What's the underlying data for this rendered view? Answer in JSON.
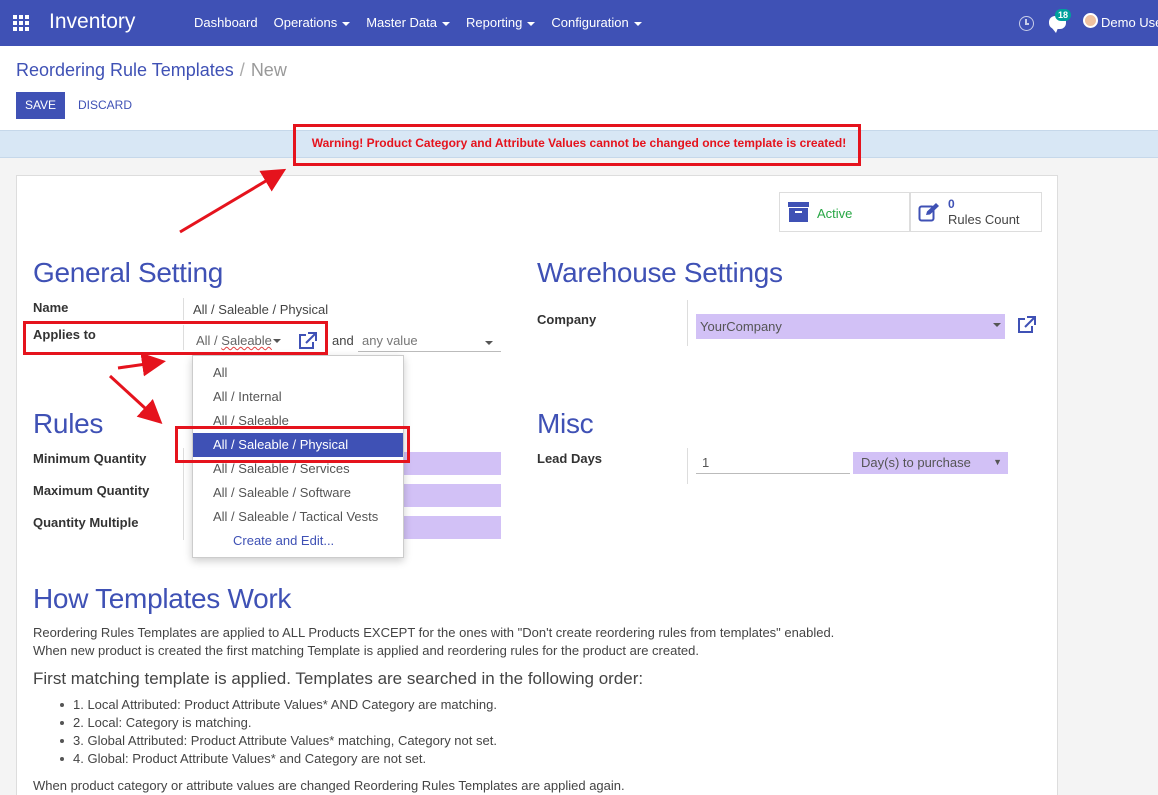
{
  "nav": {
    "app_name": "Inventory",
    "menu": [
      "Dashboard",
      "Operations",
      "Master Data",
      "Reporting",
      "Configuration"
    ],
    "chat_count": "18",
    "user": "Demo Use"
  },
  "breadcrumb": {
    "parent": "Reordering Rule Templates",
    "separator": "/",
    "current": "New"
  },
  "buttons": {
    "save": "SAVE",
    "discard": "DISCARD"
  },
  "warning": "Warning! Product Category and Attribute Values cannot be changed once template is created!",
  "stats": {
    "active_label": "Active",
    "rules_count": "0",
    "rules_label": "Rules Count"
  },
  "general": {
    "title": "General Setting",
    "name_label": "Name",
    "name_value": "All / Saleable / Physical",
    "applies_label": "Applies to",
    "applies_prefix": "All / ",
    "applies_value": "Saleable",
    "and_label": "and",
    "attribute_placeholder": "any value"
  },
  "dropdown": {
    "items": [
      "All",
      "All / Internal",
      "All / Saleable",
      "All / Saleable / Physical",
      "All / Saleable / Services",
      "All / Saleable / Software",
      "All / Saleable / Tactical Vests"
    ],
    "selected_index": 3,
    "create_edit": "Create and Edit..."
  },
  "warehouse": {
    "title": "Warehouse Settings",
    "company_label": "Company",
    "company_value": "YourCompany"
  },
  "rules": {
    "title": "Rules",
    "labels": [
      "Minimum Quantity",
      "Maximum Quantity",
      "Quantity Multiple"
    ]
  },
  "misc": {
    "title": "Misc",
    "lead_days_label": "Lead Days",
    "lead_days_value": "1",
    "lead_days_unit": "Day(s) to purchase"
  },
  "how": {
    "title": "How Templates Work",
    "para1": "Reordering Rules Templates are applied to ALL Products EXCEPT for the ones with \"Don't create reordering rules from templates\" enabled.",
    "para2": "When new product is created the first matching Template is applied and reordering rules for the product are created.",
    "subhead": "First matching template is applied. Templates are searched in the following order:",
    "bullets": [
      "1. Local Attributed: Product Attribute Values* AND Category are matching.",
      "2. Local: Category is matching.",
      "3. Global Attributed: Product Attribute Values* matching, Category not set.",
      "4. Global: Product Attribute Values* and Category are not set."
    ],
    "para3": "When product category or attribute values are changed Reordering Rules Templates are applied again."
  },
  "colors": {
    "primary": "#3F51B5",
    "required_field": "#d2c1f6",
    "annotation": "#e5131d",
    "active": "#28a745"
  }
}
